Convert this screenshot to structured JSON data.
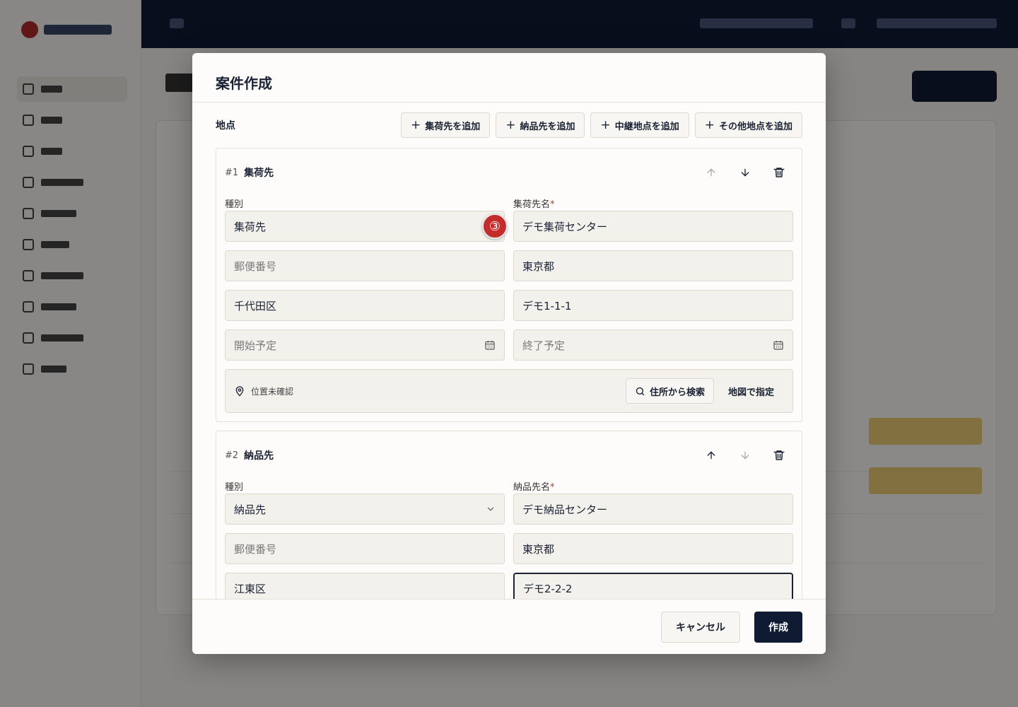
{
  "modal": {
    "title": "案件作成",
    "locations_title": "地点",
    "add_buttons": [
      {
        "label": "集荷先を追加",
        "icon": "plus-icon"
      },
      {
        "label": "納品先を追加",
        "icon": "plus-icon"
      },
      {
        "label": "中継地点を追加",
        "icon": "plus-icon"
      },
      {
        "label": "その他地点を追加",
        "icon": "plus-icon"
      }
    ],
    "stops": [
      {
        "number": "#1",
        "name": "集荷先",
        "type_label": "種別",
        "type_value": "集荷先",
        "type_badge": "③",
        "name_label": "集荷先名",
        "name_value": "デモ集荷センター",
        "postal_placeholder": "郵便番号",
        "prefecture": "東京都",
        "city": "千代田区",
        "address": "デモ1-1-1",
        "start_placeholder": "開始予定",
        "end_placeholder": "終了予定",
        "geo_status": "位置未確認",
        "geo_search": "住所から検索",
        "geo_map": "地図で指定"
      },
      {
        "number": "#2",
        "name": "納品先",
        "type_label": "種別",
        "type_value": "納品先",
        "name_label": "納品先名",
        "name_value": "デモ納品センター",
        "postal_placeholder": "郵便番号",
        "prefecture": "東京都",
        "city": "江東区",
        "address": "デモ2-2-2"
      }
    ],
    "required_mark": "*",
    "footer": {
      "cancel": "キャンセル",
      "create": "作成"
    }
  },
  "colors": {
    "primary": "#0f1a33",
    "required": "#c0392b",
    "badge": "#c42b2b"
  }
}
